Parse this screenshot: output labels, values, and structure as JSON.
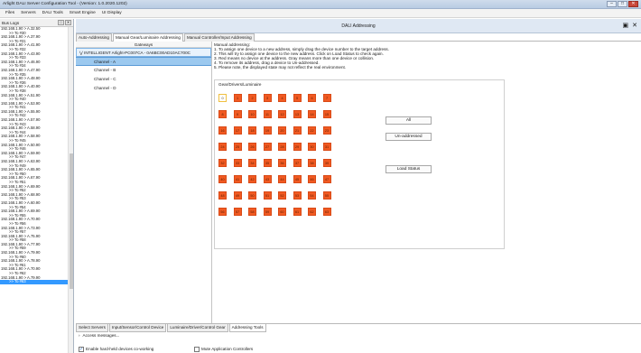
{
  "window": {
    "title": "Arlight DALI Server Configuration Tool - (Version: 1.0.2020.1202)",
    "controls": [
      "–",
      "□",
      "✕"
    ]
  },
  "menu": [
    "Files",
    "Servers",
    "DALI Tools",
    "Smart Engine",
    "UI Display"
  ],
  "left_panel": {
    "title": "Bus Logs",
    "header_buttons": [
      "□",
      "✕"
    ],
    "rows": [
      {
        "text": "192.168.1.90 > A.32.50",
        "sub": false
      },
      {
        "text": ">> To #30",
        "sub": true
      },
      {
        "text": "192.168.1.90 > A.37.90",
        "sub": false
      },
      {
        "text": ">> To #31",
        "sub": true
      },
      {
        "text": "192.168.1.90 > A.41.90",
        "sub": false
      },
      {
        "text": ">> To #32",
        "sub": true
      },
      {
        "text": "192.168.1.90 > A.43.90",
        "sub": false
      },
      {
        "text": ">> To #33",
        "sub": true
      },
      {
        "text": "192.168.1.90 > A.46.90",
        "sub": false
      },
      {
        "text": ">> To #34",
        "sub": true
      },
      {
        "text": "192.168.1.90 > A.47.90",
        "sub": false
      },
      {
        "text": ">> To #35",
        "sub": true
      },
      {
        "text": "192.168.1.90 > A.48.90",
        "sub": false
      },
      {
        "text": ">> To #36",
        "sub": true
      },
      {
        "text": "192.168.1.90 > A.40.90",
        "sub": false
      },
      {
        "text": ">> To #38",
        "sub": true
      },
      {
        "text": "192.168.1.90 > A.51.90",
        "sub": false
      },
      {
        "text": ">> To #40",
        "sub": true
      },
      {
        "text": "192.168.1.90 > A.53.90",
        "sub": false
      },
      {
        "text": ">> To #41",
        "sub": true
      },
      {
        "text": "192.168.1.90 > A.55.90",
        "sub": false
      },
      {
        "text": ">> To #42",
        "sub": true
      },
      {
        "text": "192.168.1.90 > A.57.90",
        "sub": false
      },
      {
        "text": ">> To #43",
        "sub": true
      },
      {
        "text": "192.168.1.90 > A.58.90",
        "sub": false
      },
      {
        "text": ">> To #44",
        "sub": true
      },
      {
        "text": "192.168.1.90 > A.58.90",
        "sub": false
      },
      {
        "text": ">> To #45",
        "sub": true
      },
      {
        "text": "192.168.1.90 > A.50.90",
        "sub": false
      },
      {
        "text": ">> To #46",
        "sub": true
      },
      {
        "text": "192.168.1.90 > A.59.90",
        "sub": false
      },
      {
        "text": ">> To #47",
        "sub": true
      },
      {
        "text": "192.168.1.90 > A.63.90",
        "sub": false
      },
      {
        "text": ">> To #49",
        "sub": true
      },
      {
        "text": "192.168.1.90 > A.65.90",
        "sub": false
      },
      {
        "text": ">> To #50",
        "sub": true
      },
      {
        "text": "192.168.1.90 > A.67.90",
        "sub": false
      },
      {
        "text": ">> To #51",
        "sub": true
      },
      {
        "text": "192.168.1.90 > A.69.90",
        "sub": false
      },
      {
        "text": ">> To #52",
        "sub": true
      },
      {
        "text": "192.168.1.90 > A.68.90",
        "sub": false
      },
      {
        "text": ">> To #53",
        "sub": true
      },
      {
        "text": "192.168.1.90 > A.60.90",
        "sub": false
      },
      {
        "text": ">> To #54",
        "sub": true
      },
      {
        "text": "192.168.1.90 > A.69.90",
        "sub": false
      },
      {
        "text": ">> To #55",
        "sub": true
      },
      {
        "text": "192.168.1.90 > A.70.90",
        "sub": false
      },
      {
        "text": ">> To #56",
        "sub": true
      },
      {
        "text": "192.168.1.90 > A.73.90",
        "sub": false
      },
      {
        "text": ">> To #57",
        "sub": true
      },
      {
        "text": "192.168.1.90 > A.75.90",
        "sub": false
      },
      {
        "text": ">> To #58",
        "sub": true
      },
      {
        "text": "192.168.1.90 > A.77.90",
        "sub": false
      },
      {
        "text": ">> To #59",
        "sub": true
      },
      {
        "text": "192.168.1.90 > A.79.90",
        "sub": false
      },
      {
        "text": ">> To #60",
        "sub": true
      },
      {
        "text": "192.168.1.90 > A.78.90",
        "sub": false
      },
      {
        "text": ">> To #61",
        "sub": true
      },
      {
        "text": "192.168.1.90 > A.70.90",
        "sub": false
      },
      {
        "text": ">> To #62",
        "sub": true
      },
      {
        "text": "192.168.1.90 > A.79.90",
        "sub": false
      },
      {
        "text": ">> To #63",
        "sub": true,
        "selected": true
      }
    ]
  },
  "document": {
    "title": "DALI Addressing",
    "controls": [
      "▣",
      "✕"
    ]
  },
  "tabs": [
    {
      "label": "Auto-Addressing",
      "active": false
    },
    {
      "label": "Manual Gear/Luminaire Addressing",
      "active": true
    },
    {
      "label": "Manual Controller/Input Addressing",
      "active": false
    }
  ],
  "gateways": {
    "header": "Gateways",
    "gateway": {
      "expander": "⋁",
      "label": "INTELLIGENT Arlight-PC007CA - 0A6BC00AD10AC700C"
    },
    "channels": [
      {
        "label": "Channel - A",
        "selected": true
      },
      {
        "label": "Channel - B",
        "selected": false
      },
      {
        "label": "Channel - C",
        "selected": false
      },
      {
        "label": "Channel - D",
        "selected": false
      }
    ]
  },
  "instructions": [
    "Manual addressing:",
    "1. To assign one device to a new address, simply drag the device number to the target address.",
    "2. This will try to assign one device to the new address. Click on Load Status to check again.",
    "3. Red means no device at the address. Gray means more than one device or collision.",
    "4. To remove its address, drag a device to Un-addressed.",
    "5. Please note, the displayed state may not reflect the real environment."
  ],
  "address_grid": {
    "label": "Gear/Drivers/Luminaire",
    "rows": 8,
    "cols": 8,
    "free_addresses": [
      0
    ],
    "colors": {
      "used": "#f15a22",
      "free": "#ffffff"
    }
  },
  "buttons": {
    "all": "All",
    "unaddressed": "Un-addressed",
    "load_status": "Load Status"
  },
  "bottom_tabs": [
    {
      "label": "Select Servers",
      "active": false
    },
    {
      "label": "Input/Sensor/Control Device",
      "active": false
    },
    {
      "label": "Luminaire/Driver/Control Gear",
      "active": false
    },
    {
      "label": "Addressing Tools",
      "active": true
    }
  ],
  "access": {
    "expander": "›",
    "text": "Access messages..."
  },
  "options": {
    "enable_cowork": {
      "label": "Enable hard-held devices co-working",
      "checked": true,
      "mark": "✓"
    },
    "mute_controllers": {
      "label": "Mute Application Controllers",
      "checked": false
    }
  }
}
